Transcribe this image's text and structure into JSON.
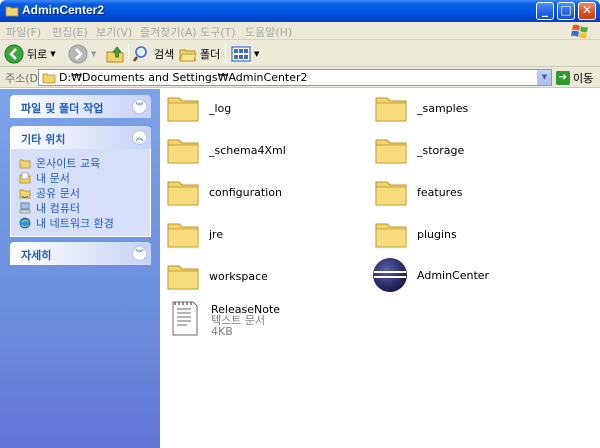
{
  "window": {
    "title": "AdminCenter2",
    "controls": {
      "minimize": "_",
      "maximize": "□",
      "close": "✕"
    }
  },
  "menu": {
    "items": [
      "파일(F)",
      "편집(E)",
      "보기(V)",
      "즐겨찾기(A)",
      "도구(T)",
      "도움말(H)"
    ]
  },
  "toolbar": {
    "back_label": "뒤로",
    "search_label": "검색",
    "folders_label": "폴더"
  },
  "address": {
    "label": "주소(D)",
    "value": "D:₩Documents and Settings₩AdminCenter2",
    "go_label": "이동"
  },
  "sidebar": {
    "panels": [
      {
        "title": "파일 및 폴더 작업",
        "expanded": false,
        "links": []
      },
      {
        "title": "기타 위치",
        "expanded": true,
        "links": [
          {
            "label": "온사이트 교육",
            "icon": "folder-icon"
          },
          {
            "label": "내 문서",
            "icon": "my-documents-icon"
          },
          {
            "label": "공유 문서",
            "icon": "shared-folder-icon"
          },
          {
            "label": "내 컴퓨터",
            "icon": "my-computer-icon"
          },
          {
            "label": "내 네트워크 환경",
            "icon": "network-icon"
          }
        ]
      },
      {
        "title": "자세히",
        "expanded": false,
        "links": []
      }
    ]
  },
  "files": [
    {
      "name": "_log",
      "type": "folder"
    },
    {
      "name": "_samples",
      "type": "folder"
    },
    {
      "name": "_schema4Xml",
      "type": "folder"
    },
    {
      "name": "_storage",
      "type": "folder"
    },
    {
      "name": "configuration",
      "type": "folder"
    },
    {
      "name": "features",
      "type": "folder"
    },
    {
      "name": "jre",
      "type": "folder"
    },
    {
      "name": "plugins",
      "type": "folder"
    },
    {
      "name": "workspace",
      "type": "folder"
    },
    {
      "name": "AdminCenter",
      "type": "application"
    },
    {
      "name": "ReleaseNote",
      "type": "text-document",
      "kind": "텍스트 문서",
      "size": "4KB"
    }
  ]
}
